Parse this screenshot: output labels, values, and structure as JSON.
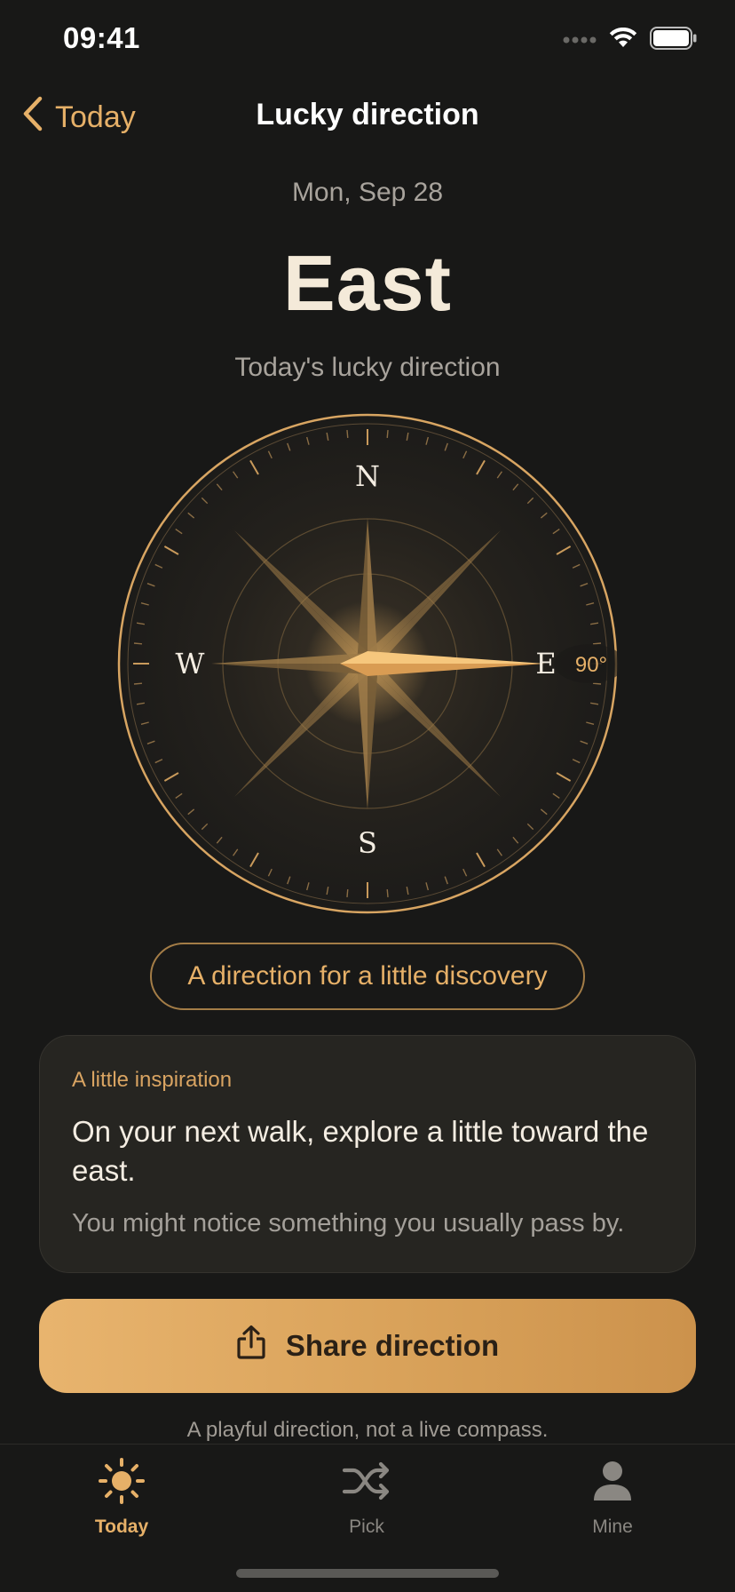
{
  "status_bar": {
    "time": "09:41",
    "icons": [
      "signal-dots-icon",
      "wifi-icon",
      "battery-icon"
    ]
  },
  "nav": {
    "back_label": "Today",
    "title": "Lucky direction"
  },
  "date": "Mon, Sep 28",
  "direction": {
    "name": "East",
    "caption": "Today's lucky direction",
    "degrees_label": "90°",
    "bearing_degrees": 90
  },
  "compass": {
    "north": "N",
    "south": "S",
    "east": "E",
    "west": "W"
  },
  "pill_text": "A direction for a little discovery",
  "inspiration": {
    "label": "A little inspiration",
    "title": "On your next walk, explore a little toward the east.",
    "body": "You might notice something you usually pass by."
  },
  "share_button": {
    "label": "Share direction",
    "icon": "share-icon"
  },
  "footnote": "A playful direction, not a live compass.",
  "tabs": [
    {
      "label": "Today",
      "icon": "sun-icon",
      "active": true
    },
    {
      "label": "Pick",
      "icon": "shuffle-icon",
      "active": false
    },
    {
      "label": "Mine",
      "icon": "person-icon",
      "active": false
    }
  ],
  "colors": {
    "background": "#181817",
    "accent": "#e6b068",
    "card": "#262521"
  }
}
